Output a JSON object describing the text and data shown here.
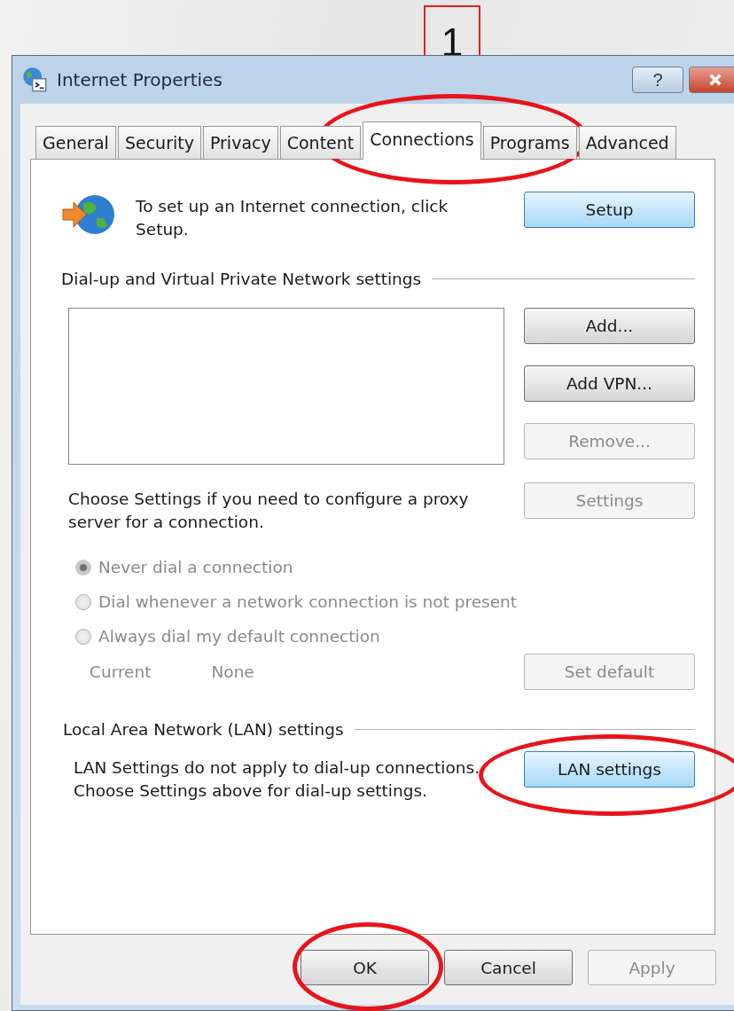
{
  "annotation": {
    "step": "1"
  },
  "window": {
    "title": "Internet Properties",
    "help_label": "?"
  },
  "tabs": [
    {
      "label": "General",
      "selected": false
    },
    {
      "label": "Security",
      "selected": false
    },
    {
      "label": "Privacy",
      "selected": false
    },
    {
      "label": "Content",
      "selected": false
    },
    {
      "label": "Connections",
      "selected": true
    },
    {
      "label": "Programs",
      "selected": false
    },
    {
      "label": "Advanced",
      "selected": false
    }
  ],
  "setup": {
    "text": "To set up an Internet connection, click Setup.",
    "button": {
      "label": "Setup",
      "highlighted": true
    }
  },
  "dialup": {
    "heading": "Dial-up and Virtual Private Network settings",
    "buttons": [
      {
        "label": "Add...",
        "disabled": false
      },
      {
        "label": "Add VPN...",
        "disabled": false
      },
      {
        "label": "Remove...",
        "disabled": true
      }
    ],
    "proxy_text": "Choose Settings if you need to configure a proxy server for a connection.",
    "settings_button": {
      "label": "Settings",
      "disabled": true
    },
    "options": [
      {
        "label": "Never dial a connection",
        "selected": true,
        "disabled": true
      },
      {
        "label": "Dial whenever a network connection is not present",
        "selected": false,
        "disabled": true
      },
      {
        "label": "Always dial my default connection",
        "selected": false,
        "disabled": true
      }
    ],
    "current_label": "Current",
    "current_value": "None",
    "set_default": {
      "label": "Set default",
      "disabled": true
    }
  },
  "lan": {
    "heading": "Local Area Network (LAN) settings",
    "lines": [
      "LAN Settings do not apply to dial-up connections.",
      "Choose Settings above for dial-up settings."
    ],
    "button": {
      "label": "LAN settings",
      "highlighted": true
    }
  },
  "footer_buttons": [
    {
      "label": "OK",
      "disabled": false
    },
    {
      "label": "Cancel",
      "disabled": false
    },
    {
      "label": "Apply",
      "disabled": true
    }
  ]
}
